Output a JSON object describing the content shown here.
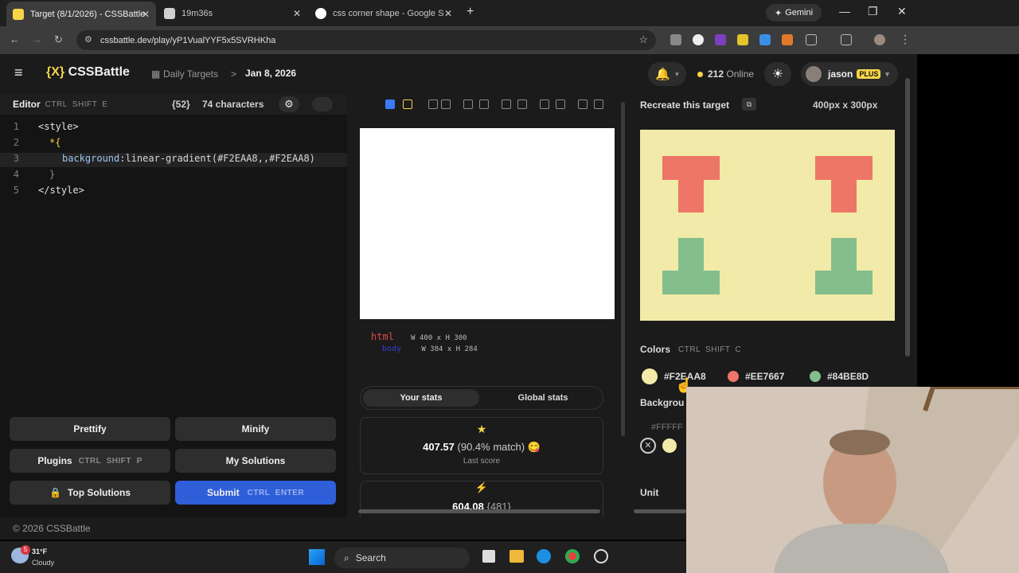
{
  "browser": {
    "tabs": [
      {
        "title": "Target (8/1/2026) - CSSBattle",
        "active": true
      },
      {
        "title": "19m36s",
        "active": false
      },
      {
        "title": "css corner shape - Google Sear",
        "active": false
      }
    ],
    "new_tab": "+",
    "gemini_label": "Gemini",
    "url": "cssbattle.dev/play/yP1VualYYF5x5SVRHKha"
  },
  "header": {
    "logo_bracket": "{X}",
    "logo_text": "CSSBattle",
    "breadcrumb": "Daily Targets",
    "breadcrumb_sep": ">",
    "date": "Jan 8, 2026",
    "online_count": "212",
    "online_label": "Online",
    "username": "jason",
    "plan_badge": "PLUS"
  },
  "editor": {
    "title": "Editor",
    "shortcut": [
      "CTRL",
      "SHIFT",
      "E"
    ],
    "char_badge": "{52}",
    "char_count": "74 characters",
    "lines": [
      {
        "n": "1",
        "text": "<style>"
      },
      {
        "n": "2",
        "text": "*{"
      },
      {
        "n": "3",
        "prop": "background",
        "value": ":linear-gradient(#F2EAA8,,#F2EAA8)"
      },
      {
        "n": "4",
        "text": "}"
      },
      {
        "n": "5",
        "text": "</style>"
      }
    ]
  },
  "actions": {
    "prettify": "Prettify",
    "minify": "Minify",
    "plugins": "Plugins",
    "plugins_shortcut": "CTRL  SHIFT  P",
    "my_solutions": "My Solutions",
    "top_solutions": "Top Solutions",
    "submit": "Submit",
    "submit_shortcut": "CTRL  ENTER"
  },
  "preview": {
    "html_tag": "html",
    "html_dims": "W 400 x H 300",
    "body_tag": "body",
    "body_dims": "W 384 x H 284",
    "tab_your": "Your stats",
    "tab_global": "Global stats",
    "score": "407.57",
    "match": "(90.4% match)",
    "score_label": "Last score",
    "second_score": "604.08",
    "second_badge": "{481}"
  },
  "target": {
    "title": "Recreate this target",
    "size": "400px x 300px",
    "colors_title": "Colors",
    "colors_shortcut": [
      "CTRL",
      "SHIFT",
      "C"
    ],
    "colors": [
      {
        "hex": "#F2EAA8",
        "swatch": "#F2EAA8"
      },
      {
        "hex": "#EE7667",
        "swatch": "#EE7667"
      },
      {
        "hex": "#84BE8D",
        "swatch": "#84BE8D"
      }
    ],
    "background_title": "Backgrou",
    "background_value": "#FFFFF",
    "unit_title": "Unit"
  },
  "footer": {
    "copyright": "© 2026 CSSBattle"
  },
  "taskbar": {
    "weather_temp": "31°F",
    "weather_desc": "Cloudy",
    "search": "Search",
    "badge": "5"
  }
}
